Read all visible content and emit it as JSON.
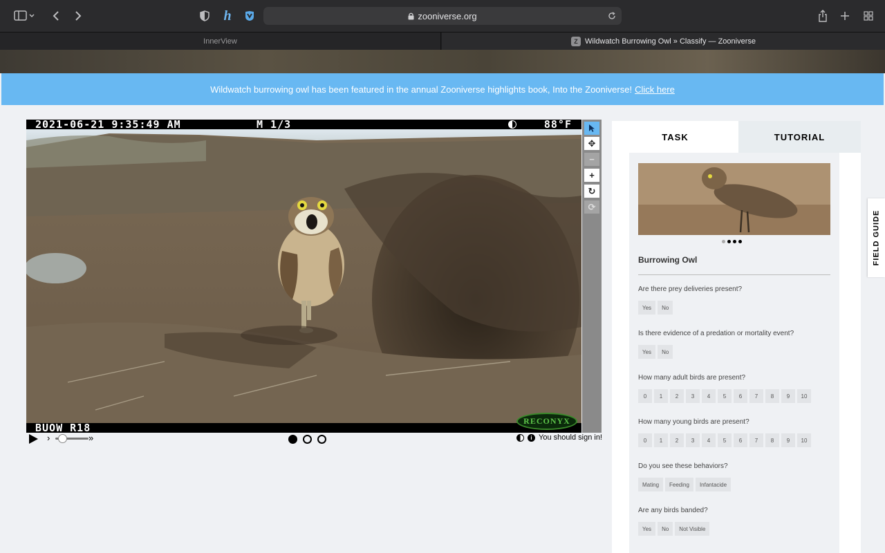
{
  "browser": {
    "address": "zooniverse.org",
    "tabs": [
      {
        "label": "InnerView",
        "active": false
      },
      {
        "label": "Wildwatch Burrowing Owl » Classify — Zooniverse",
        "favicon": "Z",
        "active": true
      }
    ]
  },
  "banner": {
    "text": "Wildwatch burrowing owl has been featured in the annual Zooniverse highlights book, Into the Zooniverse!",
    "link": "Click here"
  },
  "camera": {
    "timestamp": "2021-06-21 9:35:49 AM",
    "frame": "M 1/3",
    "temperature": "88°F",
    "camera_id": "BUOW R18",
    "brand": "RECONYX"
  },
  "controls": {
    "signin": "You should sign in!"
  },
  "panel": {
    "tab_task": "TASK",
    "tab_tutorial": "TUTORIAL",
    "species": "Burrowing Owl",
    "questions": [
      {
        "text": "Are there prey deliveries present?",
        "options": [
          "Yes",
          "No"
        ]
      },
      {
        "text": "Is there evidence of a predation or mortality event?",
        "options": [
          "Yes",
          "No"
        ]
      },
      {
        "text": "How many adult birds are present?",
        "options": [
          "0",
          "1",
          "2",
          "3",
          "4",
          "5",
          "6",
          "7",
          "8",
          "9",
          "10"
        ]
      },
      {
        "text": "How many young birds are present?",
        "options": [
          "0",
          "1",
          "2",
          "3",
          "4",
          "5",
          "6",
          "7",
          "8",
          "9",
          "10"
        ]
      },
      {
        "text": "Do you see these behaviors?",
        "options": [
          "Mating",
          "Feeding",
          "Infantacide"
        ]
      },
      {
        "text": "Are any birds banded?",
        "options": [
          "Yes",
          "No",
          "Not Visible"
        ]
      }
    ]
  },
  "field_guide": "FIELD GUIDE"
}
